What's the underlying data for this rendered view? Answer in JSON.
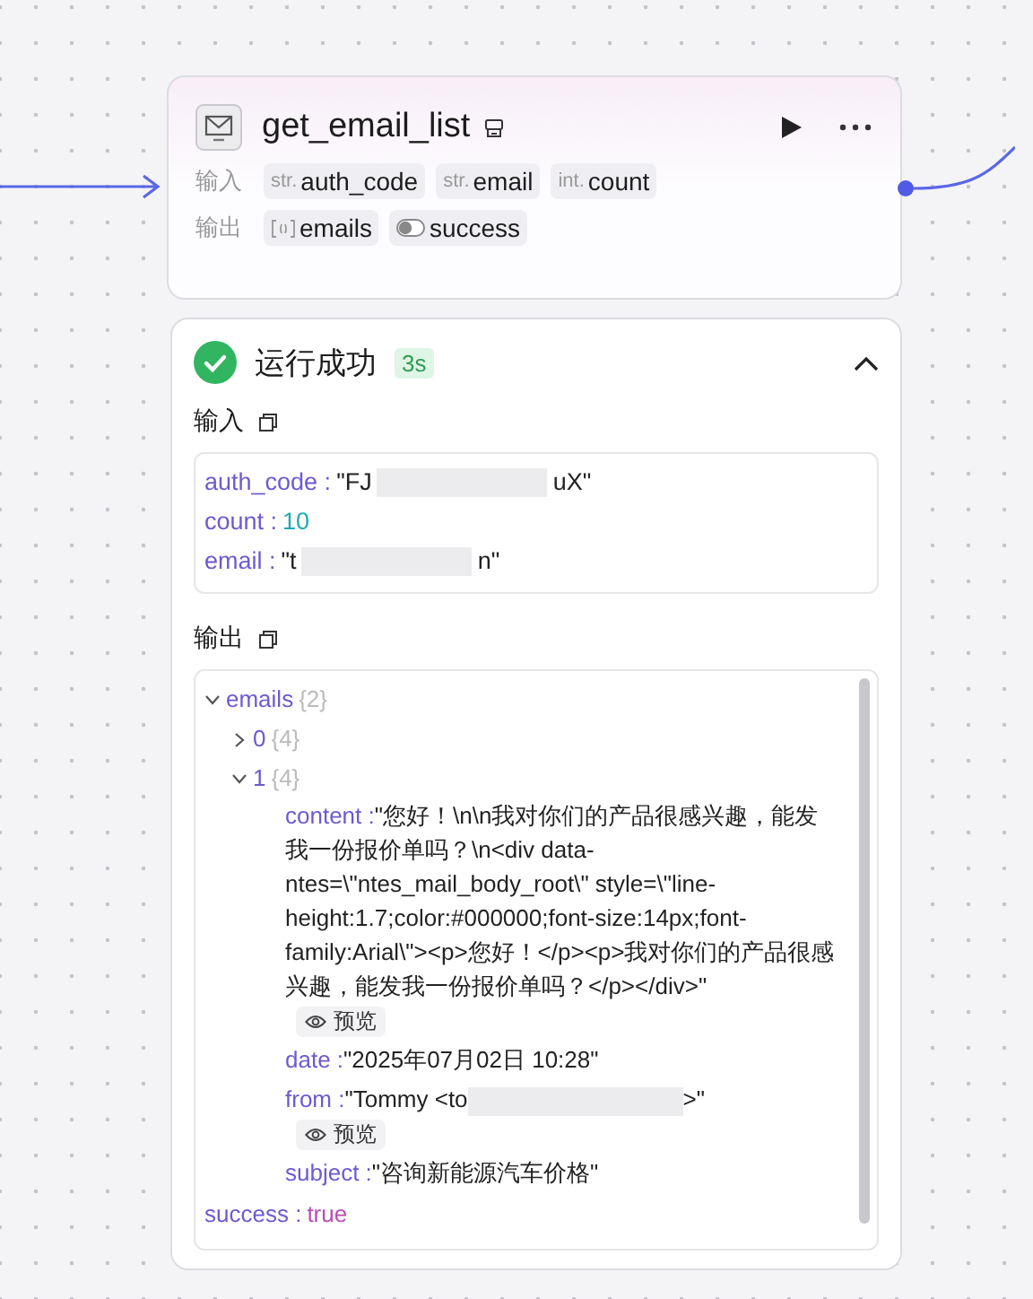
{
  "node": {
    "title": "get_email_list",
    "input_label": "输入",
    "inputs": [
      {
        "type": "str.",
        "name": "auth_code"
      },
      {
        "type": "str.",
        "name": "email"
      },
      {
        "type": "int.",
        "name": "count"
      }
    ],
    "output_label": "输出",
    "outputs": [
      {
        "kind": "array",
        "name": "emails"
      },
      {
        "kind": "bool",
        "name": "success"
      }
    ]
  },
  "result": {
    "status": "运行成功",
    "duration": "3s",
    "expanded": true,
    "input_title": "输入",
    "input_fields": [
      {
        "key": "auth_code :",
        "kind": "string",
        "start": "\"FJ",
        "end": "uX\""
      },
      {
        "key": "count :",
        "kind": "number",
        "start": "10"
      },
      {
        "key": "email :",
        "kind": "string",
        "start": "\"t",
        "end": "n\""
      }
    ],
    "output_title": "输出",
    "output_tree": [
      {
        "key": "emails",
        "count": "{2}",
        "expanded": true,
        "children": [
          {
            "key": "0",
            "count": "{4}",
            "expanded": false
          },
          {
            "key": "1",
            "count": "{4}",
            "expanded": true,
            "children": [
              {
                "key": "content :",
                "kind": "string",
                "start": "\"您好！\\n\\n我对你们的产品很感兴趣，能发我一份报价单吗？\\n<div data-ntes=\\\"ntes_mail_body_root\\\" style=\\\"line-height:1.7;color:#000000;font-size:14px;font-family:Arial\\\"><p>您好！</p><p>我对你们的产品很感兴趣，能发我一份报价单吗？</p></div>\"",
                "preview": "预览"
              },
              {
                "key": "date :",
                "kind": "string",
                "start": "\"2025年07月02日 10:28\""
              },
              {
                "key": "from :",
                "kind": "string",
                "start": "\"Tommy <to",
                "end": ">\"",
                "preview": "预览"
              },
              {
                "key": "subject :",
                "kind": "string",
                "start": "\"咨询新能源汽车价格\""
              }
            ]
          }
        ]
      },
      {
        "key": "success :",
        "kind": "bool",
        "start": "true"
      }
    ]
  }
}
